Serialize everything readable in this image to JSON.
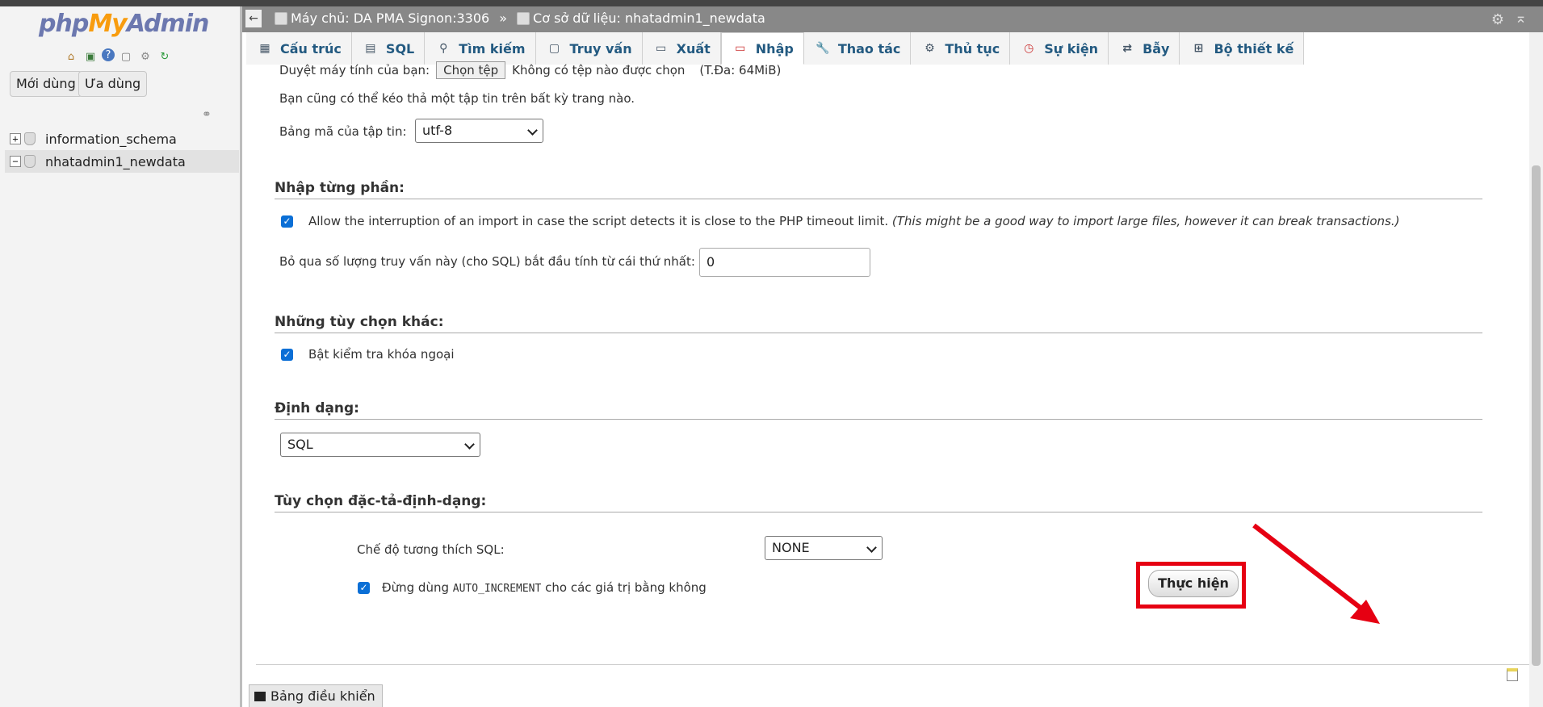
{
  "app": {
    "logo_php": "php",
    "logo_my": "My",
    "logo_admin": "Admin"
  },
  "sidebar": {
    "buttons": [
      "Mới dùng",
      "Ưa dùng"
    ],
    "databases": [
      {
        "name": "information_schema",
        "expander": "+"
      },
      {
        "name": "nhatadmin1_newdata",
        "expander": "−"
      }
    ]
  },
  "header": {
    "server": "Máy chủ: DA PMA Signon:3306",
    "separator": "»",
    "database": "Cơ sở dữ liệu: nhatadmin1_newdata"
  },
  "tabs": [
    {
      "label": "Cấu trúc",
      "icon": "structure-icon"
    },
    {
      "label": "SQL",
      "icon": "sql-icon"
    },
    {
      "label": "Tìm kiếm",
      "icon": "search-icon"
    },
    {
      "label": "Truy vấn",
      "icon": "query-icon"
    },
    {
      "label": "Xuất",
      "icon": "export-icon"
    },
    {
      "label": "Nhập",
      "icon": "import-icon"
    },
    {
      "label": "Thao tác",
      "icon": "wrench-icon"
    },
    {
      "label": "Thủ tục",
      "icon": "routines-icon"
    },
    {
      "label": "Sự kiện",
      "icon": "clock-icon"
    },
    {
      "label": "Bẫy",
      "icon": "trigger-icon"
    },
    {
      "label": "Bộ thiết kế",
      "icon": "designer-icon"
    }
  ],
  "active_tab": "Nhập",
  "upload": {
    "browse_label": "Duyệt máy tính của bạn:",
    "choose_file": "Chọn tệp",
    "no_file": "Không có tệp nào được chọn",
    "max": "(T.Đa: 64MiB)",
    "drag_hint": "Bạn cũng có thể kéo thả một tập tin trên bất kỳ trang nào.",
    "charset_label": "Bảng mã của tập tin:",
    "charset_value": "utf-8"
  },
  "partial": {
    "title": "Nhập từng phần:",
    "allow_interrupt": "Allow the interruption of an import in case the script detects it is close to the PHP timeout limit.",
    "allow_interrupt_note": "(This might be a good way to import large files, however it can break transactions.)",
    "skip_label": "Bỏ qua số lượng truy vấn này (cho SQL) bắt đầu tính từ cái thứ nhất:",
    "skip_value": "0"
  },
  "other": {
    "title": "Những tùy chọn khác:",
    "fk_checks": "Bật kiểm tra khóa ngoại"
  },
  "format": {
    "title": "Định dạng:",
    "value": "SQL"
  },
  "format_options": {
    "title": "Tùy chọn đặc-tả-định-dạng:",
    "compat_label": "Chế độ tương thích SQL:",
    "compat_value": "NONE",
    "auto_inc_prefix": "Đừng dùng",
    "auto_inc_code": "AUTO_INCREMENT",
    "auto_inc_suffix": "cho các giá trị bằng không"
  },
  "go_button": "Thực hiện",
  "console": "Bảng điều khiển",
  "annotation_color": "#e60012"
}
